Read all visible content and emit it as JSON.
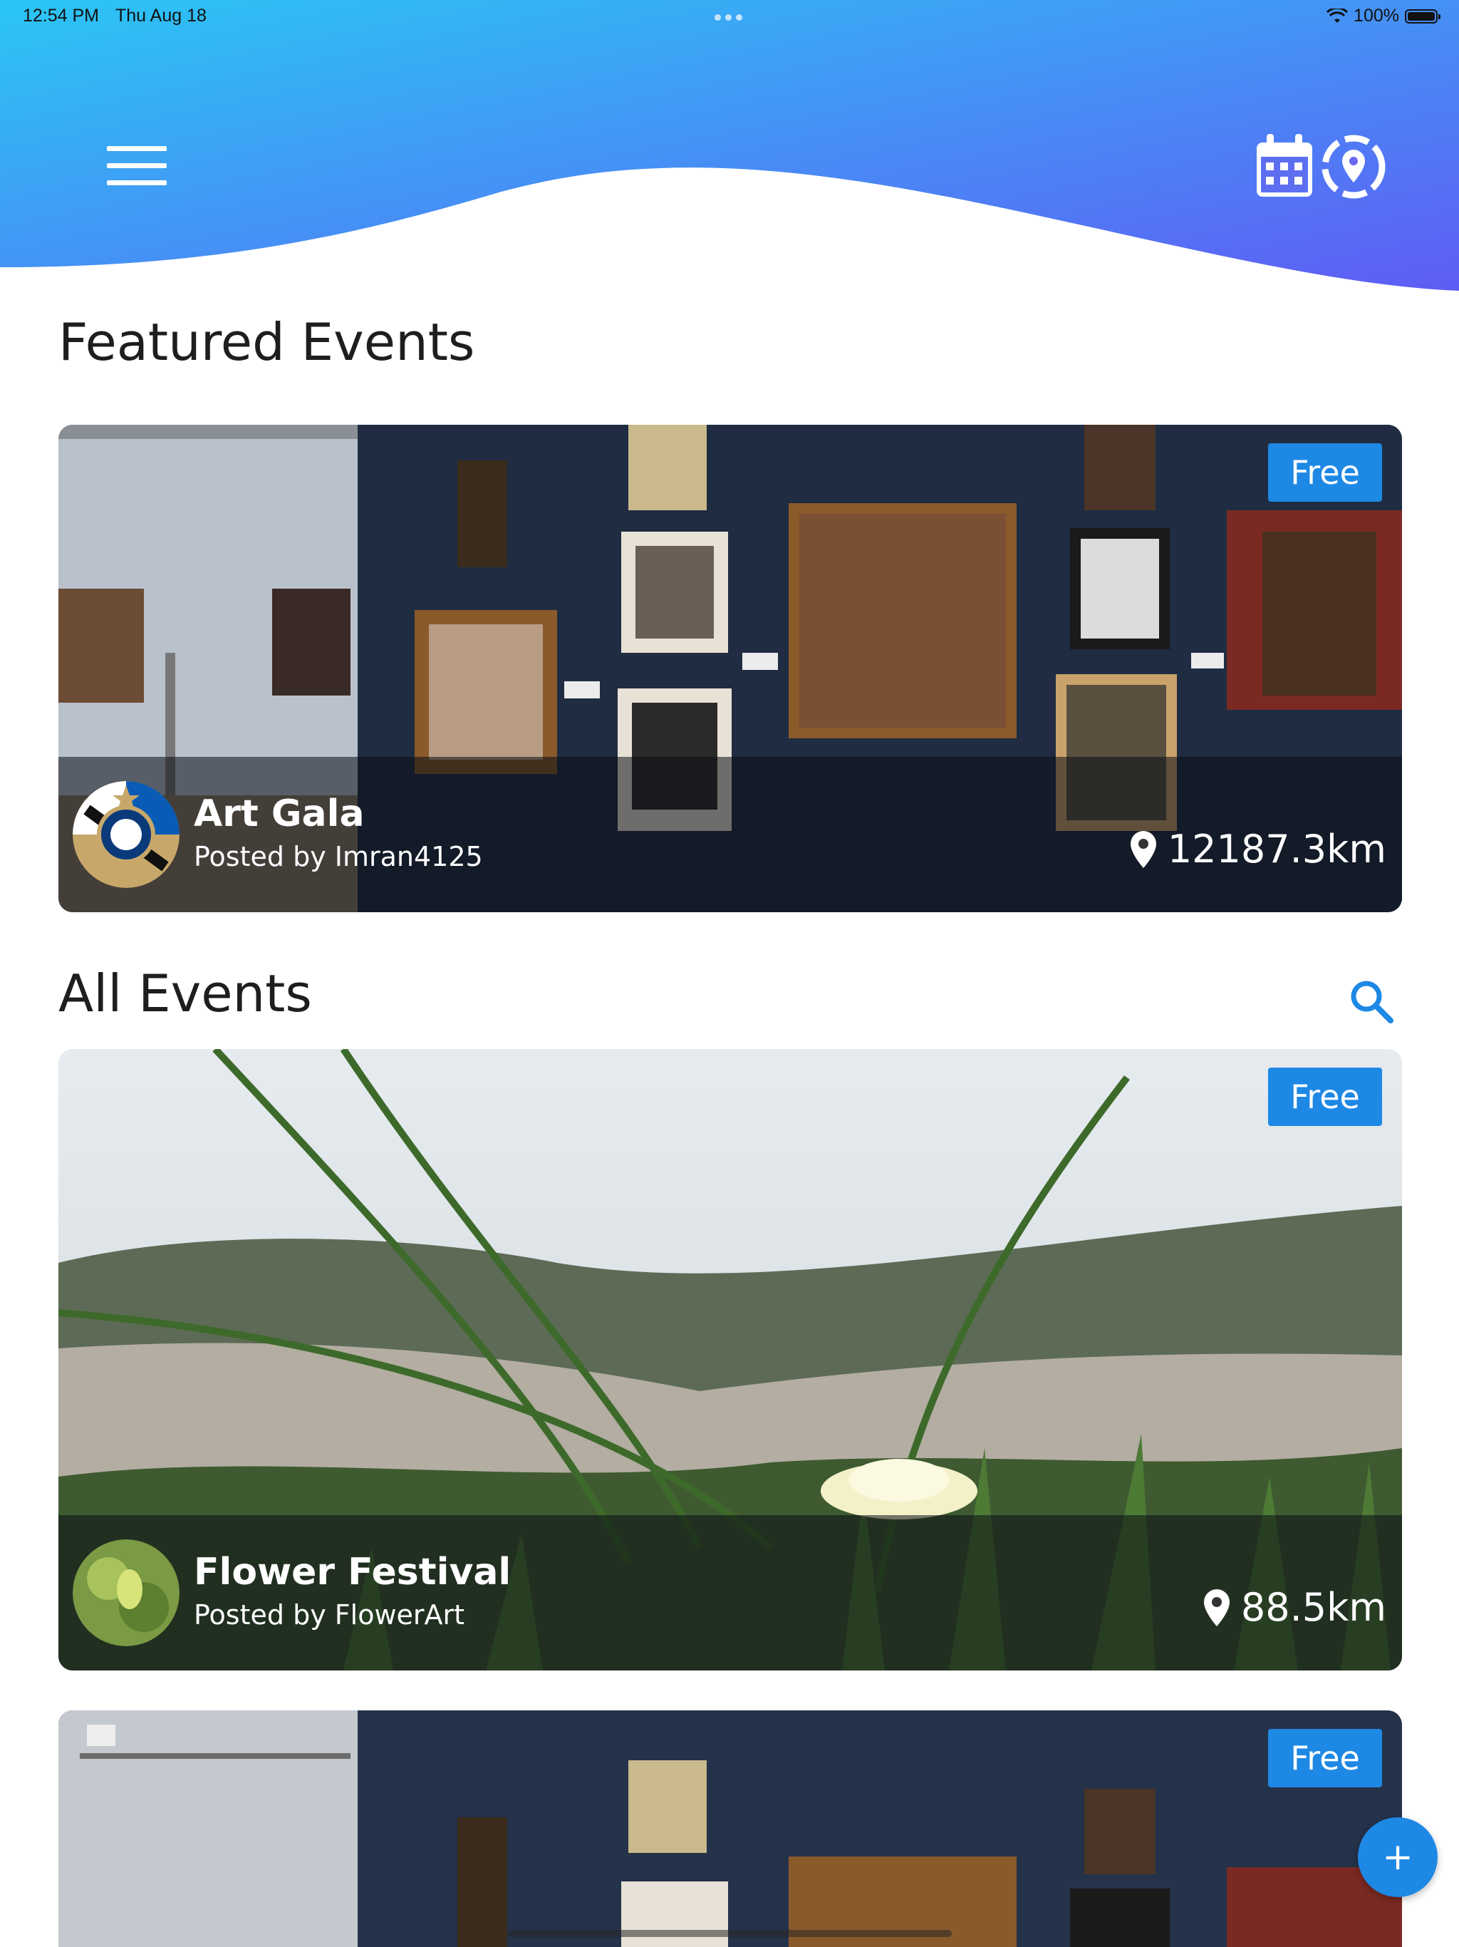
{
  "status_bar": {
    "time": "12:54 PM",
    "date": "Thu Aug 18",
    "battery": "100%"
  },
  "colors": {
    "header_gradient_start": "#2bc6f5",
    "header_gradient_end": "#5f5cf5",
    "accent": "#1e88e5"
  },
  "header": {
    "menu_icon": "hamburger-icon",
    "calendar_icon": "calendar-icon",
    "location_icon": "location-target-icon"
  },
  "featured": {
    "title": "Featured Events",
    "events": [
      {
        "title": "Art Gala",
        "poster": "Posted by Imran4125",
        "distance": "12187.3km",
        "price": "Free"
      }
    ]
  },
  "all_events": {
    "title": "All Events",
    "search_icon": "search-icon",
    "events": [
      {
        "title": "Flower Festival",
        "poster": "Posted by FlowerArt",
        "distance": "88.5km",
        "price": "Free"
      },
      {
        "title": "",
        "poster": "",
        "distance": "",
        "price": "Free"
      }
    ]
  },
  "fab": {
    "label": "+"
  }
}
